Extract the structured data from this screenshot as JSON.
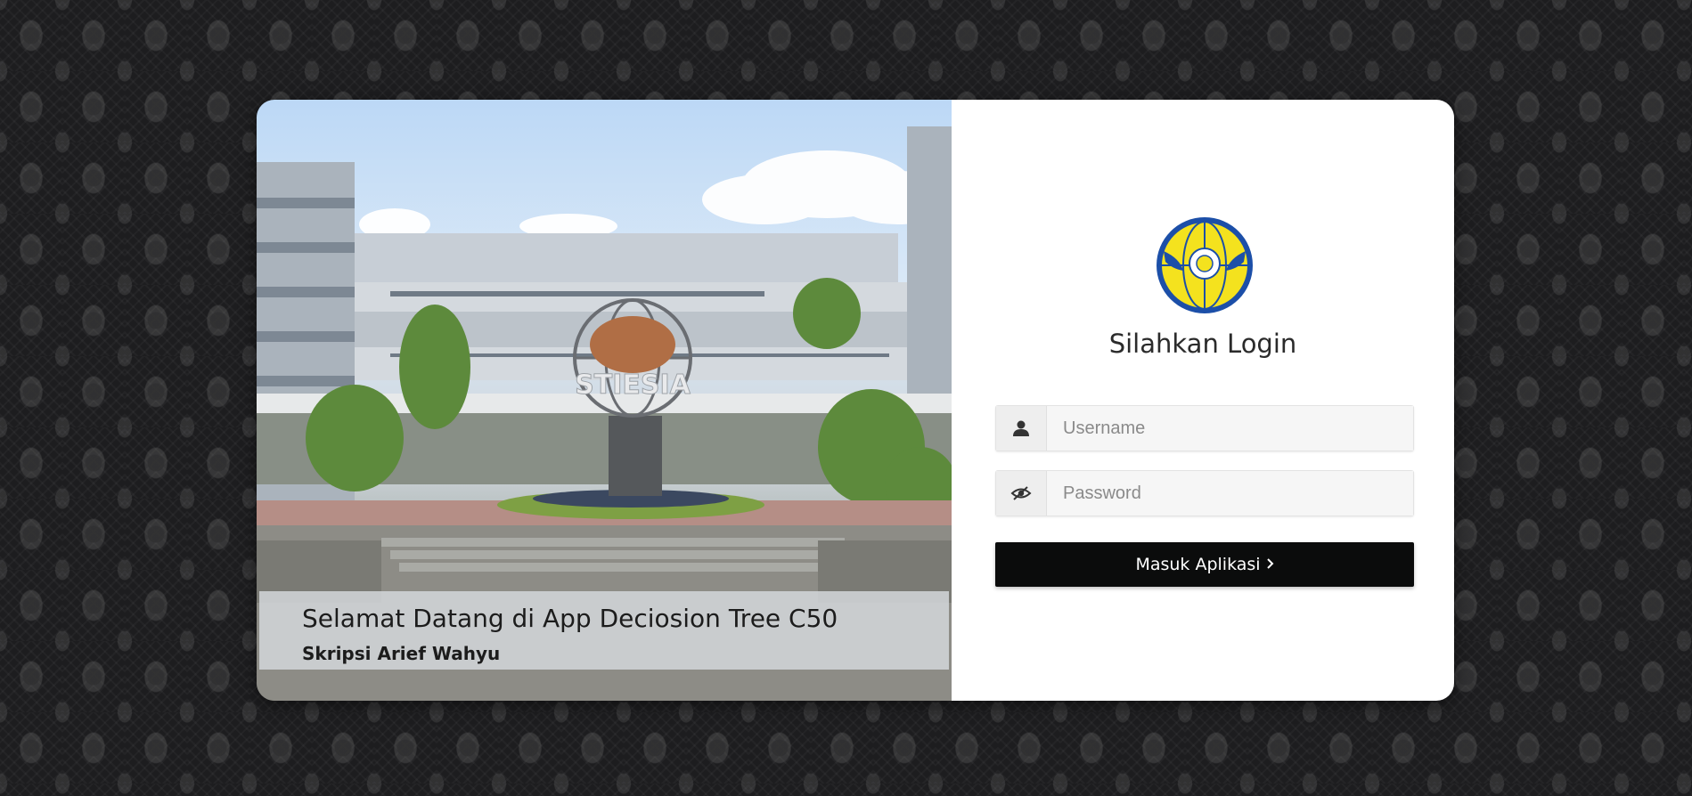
{
  "welcome": {
    "title": "Selamat Datang di App Deciosion Tree C50",
    "subtitle": "Skripsi Arief Wahyu"
  },
  "login": {
    "heading": "Silahkan Login",
    "username_placeholder": "Username",
    "password_placeholder": "Password",
    "submit_label": "Masuk Aplikasi",
    "submit_icon": "chevron-right-icon"
  },
  "photo": {
    "sign_text": "STIESIA"
  },
  "colors": {
    "button_bg": "#0b0c0c",
    "logo_blue": "#1c4fa8",
    "logo_yellow": "#f4e21e"
  }
}
